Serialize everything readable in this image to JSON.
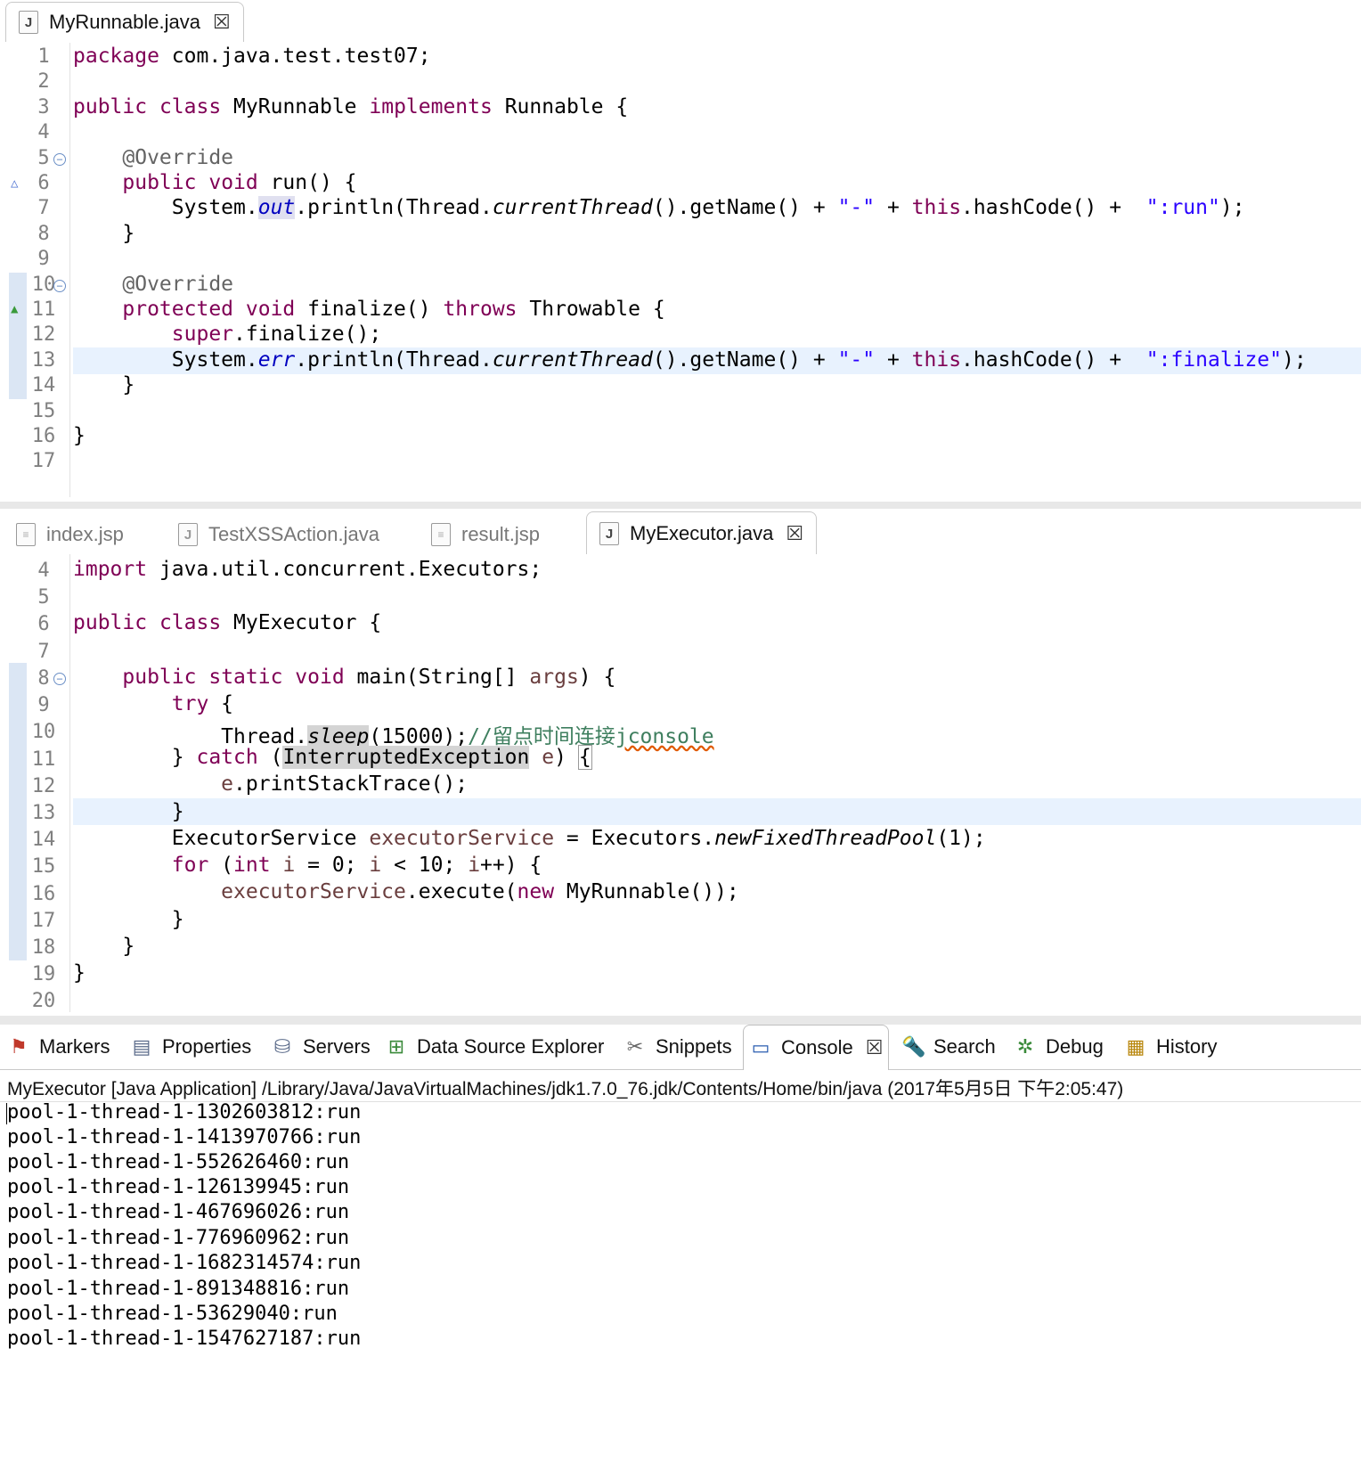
{
  "top_editor": {
    "tab": {
      "label": "MyRunnable.java",
      "icon": "java-file-icon"
    },
    "lines": [
      {
        "num": "1"
      },
      {
        "num": "2"
      },
      {
        "num": "3"
      },
      {
        "num": "4"
      },
      {
        "num": "5"
      },
      {
        "num": "6"
      },
      {
        "num": "7"
      },
      {
        "num": "8"
      },
      {
        "num": "9"
      },
      {
        "num": "10"
      },
      {
        "num": "11"
      },
      {
        "num": "12"
      },
      {
        "num": "13"
      },
      {
        "num": "14"
      },
      {
        "num": "15"
      },
      {
        "num": "16"
      },
      {
        "num": "17"
      }
    ],
    "code": {
      "l1_kw": "package",
      "l1_rest": " com.java.test.test07;",
      "l3_kw1": "public",
      "l3_kw2": "class",
      "l3_name": " MyRunnable ",
      "l3_kw3": "implements",
      "l3_rest": " Runnable {",
      "l5_ann": "@Override",
      "l6_kw1": "public",
      "l6_kw2": "void",
      "l6_rest": " run() {",
      "l7_a": "System.",
      "l7_field": "out",
      "l7_b": ".println(Thread.",
      "l7_m": "currentThread",
      "l7_c": "().getName() + ",
      "l7_s1": "\"-\"",
      "l7_d": " + ",
      "l7_this": "this",
      "l7_e": ".hashCode() +  ",
      "l7_s2": "\":run\"",
      "l7_f": ");",
      "l8": "}",
      "l10_ann": "@Override",
      "l11_kw1": "protected",
      "l11_kw2": "void",
      "l11_a": " finalize() ",
      "l11_kw3": "throws",
      "l11_b": " Throwable {",
      "l12_kw": "super",
      "l12_rest": ".finalize();",
      "l13_a": "System.",
      "l13_field": "err",
      "l13_b": ".println(Thread.",
      "l13_m": "currentThread",
      "l13_c": "().getName() + ",
      "l13_s1": "\"-\"",
      "l13_d": " + ",
      "l13_this": "this",
      "l13_e": ".hashCode() +  ",
      "l13_s2": "\":finalize\"",
      "l13_f": ");",
      "l14": "}",
      "l16": "}"
    }
  },
  "bottom_editor": {
    "tabs": [
      {
        "label": "index.jsp",
        "icon": "jsp-file-icon"
      },
      {
        "label": "TestXSSAction.java",
        "icon": "java-file-icon"
      },
      {
        "label": "result.jsp",
        "icon": "jsp-file-icon"
      },
      {
        "label": "MyExecutor.java",
        "icon": "java-file-icon",
        "active": true
      }
    ],
    "lines": [
      {
        "num": "4"
      },
      {
        "num": "5"
      },
      {
        "num": "6"
      },
      {
        "num": "7"
      },
      {
        "num": "8"
      },
      {
        "num": "9"
      },
      {
        "num": "10"
      },
      {
        "num": "11"
      },
      {
        "num": "12"
      },
      {
        "num": "13"
      },
      {
        "num": "14"
      },
      {
        "num": "15"
      },
      {
        "num": "16"
      },
      {
        "num": "17"
      },
      {
        "num": "18"
      },
      {
        "num": "19"
      },
      {
        "num": "20"
      }
    ],
    "code": {
      "l4_kw": "import",
      "l4_rest": " java.util.concurrent.Executors;",
      "l6_kw1": "public",
      "l6_kw2": "class",
      "l6_rest": " MyExecutor {",
      "l8_kw1": "public",
      "l8_kw2": "static",
      "l8_kw3": "void",
      "l8_a": " main(String[] ",
      "l8_var": "args",
      "l8_b": ") {",
      "l9_kw": "try",
      "l9_rest": " {",
      "l10_a": "Thread.",
      "l10_m": "sleep",
      "l10_b": "(15000);",
      "l10_cmt": "//留点时间连接",
      "l10_cmt2": "jconsole",
      "l11_a": "} ",
      "l11_kw": "catch",
      "l11_b": " (",
      "l11_type": "InterruptedException",
      "l11_c": " ",
      "l11_var": "e",
      "l11_d": ") ",
      "l11_e": "{",
      "l12_var": "e",
      "l12_rest": ".printStackTrace();",
      "l13": "}",
      "l14_a": "ExecutorService ",
      "l14_var": "executorService",
      "l14_b": " = Executors.",
      "l14_m": "newFixedThreadPool",
      "l14_c": "(1);",
      "l15_kw": "for",
      "l15_a": " (",
      "l15_kw2": "int",
      "l15_b": " ",
      "l15_var": "i",
      "l15_c": " = 0; ",
      "l15_var2": "i",
      "l15_d": " < 10; ",
      "l15_var3": "i",
      "l15_e": "++) {",
      "l16_var": "executorService",
      "l16_a": ".execute(",
      "l16_kw": "new",
      "l16_b": " MyRunnable());",
      "l17": "}",
      "l18": "}",
      "l19": "}"
    }
  },
  "panel": {
    "tabs": [
      {
        "label": "Markers",
        "icon": "markers-icon"
      },
      {
        "label": "Properties",
        "icon": "properties-icon"
      },
      {
        "label": "Servers",
        "icon": "servers-icon"
      },
      {
        "label": "Data Source Explorer",
        "icon": "data-source-explorer-icon"
      },
      {
        "label": "Snippets",
        "icon": "snippets-icon"
      },
      {
        "label": "Console",
        "icon": "console-icon",
        "active": true
      },
      {
        "label": "Search",
        "icon": "search-icon"
      },
      {
        "label": "Debug",
        "icon": "debug-icon"
      },
      {
        "label": "History",
        "icon": "history-icon"
      }
    ],
    "console": {
      "header": "MyExecutor [Java Application] /Library/Java/JavaVirtualMachines/jdk1.7.0_76.jdk/Contents/Home/bin/java (2017年5月5日 下午2:05:47)",
      "lines": [
        "pool-1-thread-1-1302603812:run",
        "pool-1-thread-1-1413970766:run",
        "pool-1-thread-1-552626460:run",
        "pool-1-thread-1-126139945:run",
        "pool-1-thread-1-467696026:run",
        "pool-1-thread-1-776960962:run",
        "pool-1-thread-1-1682314574:run",
        "pool-1-thread-1-891348816:run",
        "pool-1-thread-1-53629040:run",
        "pool-1-thread-1-1547627187:run"
      ]
    }
  }
}
